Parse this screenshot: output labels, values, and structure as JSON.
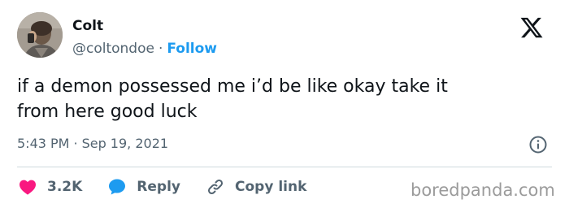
{
  "user": {
    "name": "Colt",
    "handle": "@coltondoe",
    "separator": "·",
    "follow_label": "Follow"
  },
  "tweet": {
    "lines": [
      "if a demon possessed me i’d be like okay take it",
      "from here good luck"
    ],
    "time": "5:43 PM",
    "separator": "·",
    "date": "Sep 19, 2021"
  },
  "actions": {
    "like_count": "3.2K",
    "reply_label": "Reply",
    "copy_link_label": "Copy link"
  },
  "icons": {
    "platform_logo": "x-logo-icon",
    "info": "info-icon",
    "like": "heart-icon",
    "reply": "speech-bubble-icon",
    "copy_link": "link-icon"
  },
  "colors": {
    "text_primary": "#0f1419",
    "text_secondary": "#536471",
    "follow_blue": "#1d9bf0",
    "like_pink": "#f91880",
    "reply_blue": "#1d9bf0",
    "divider": "#cfd9de",
    "watermark": "#9b9b9b"
  },
  "watermark": "boredpanda.com"
}
